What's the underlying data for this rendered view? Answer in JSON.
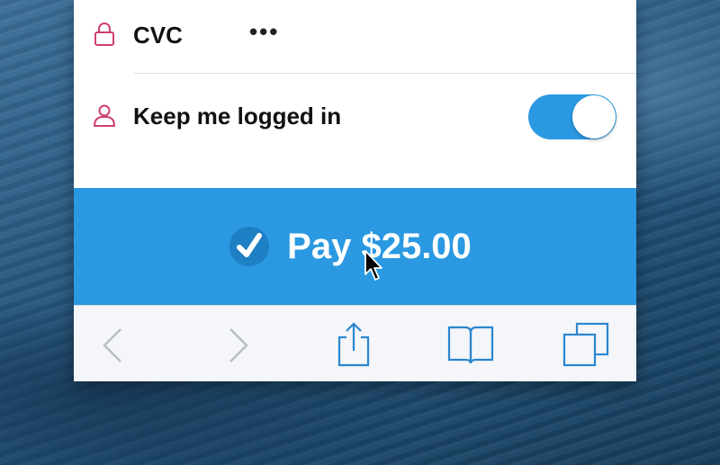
{
  "form": {
    "cvc": {
      "label": "CVC",
      "value": "•••",
      "icon": "lock-icon"
    },
    "keep_logged_in": {
      "label": "Keep me logged in",
      "icon": "user-icon",
      "enabled": true
    }
  },
  "pay_button": {
    "label": "Pay $25.00",
    "icon": "checkmark-icon"
  },
  "toolbar": {
    "items": [
      "back-chevron-icon",
      "forward-chevron-icon",
      "share-icon",
      "bookmarks-icon",
      "tabs-icon"
    ]
  },
  "colors": {
    "accent": "#2a99e2",
    "icon_pink": "#d0406c",
    "toolbar_icon": "#2a86cf",
    "disabled_icon": "#b9bec4"
  }
}
